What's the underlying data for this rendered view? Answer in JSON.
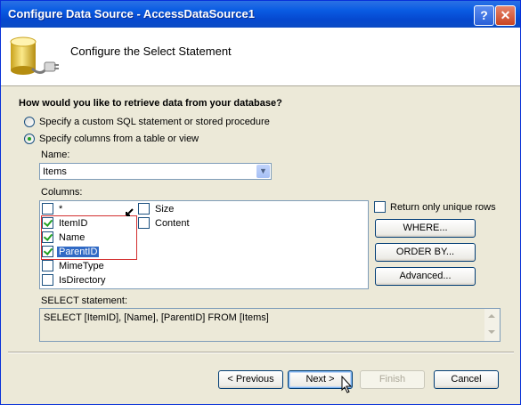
{
  "window": {
    "title": "Configure Data Source - AccessDataSource1",
    "help_glyph": "?",
    "close_glyph": "✕"
  },
  "header": {
    "title": "Configure the Select Statement",
    "icon": "database-plug-icon"
  },
  "main": {
    "question": "How would you like to retrieve data from your database?",
    "radio_custom": {
      "label": "Specify a custom SQL statement or stored procedure",
      "selected": false
    },
    "radio_columns": {
      "label": "Specify columns from a table or view",
      "selected": true
    },
    "name_label": "Name:",
    "name_value": "Items",
    "columns_label": "Columns:",
    "columns": [
      {
        "label": "*",
        "checked": false
      },
      {
        "label": "ItemID",
        "checked": true
      },
      {
        "label": "Name",
        "checked": true
      },
      {
        "label": "ParentID",
        "checked": true,
        "highlighted": true
      },
      {
        "label": "MimeType",
        "checked": false
      },
      {
        "label": "IsDirectory",
        "checked": false
      },
      {
        "label": "Size",
        "checked": false
      },
      {
        "label": "Content",
        "checked": false
      }
    ],
    "unique_rows_label": "Return only unique rows",
    "where_button": "WHERE...",
    "orderby_button": "ORDER BY...",
    "advanced_button": "Advanced...",
    "select_label": "SELECT statement:",
    "select_statement": "SELECT [ItemID], [Name], [ParentID] FROM [Items]"
  },
  "footer": {
    "previous": "< Previous",
    "next": "Next >",
    "finish": "Finish",
    "cancel": "Cancel"
  },
  "colors": {
    "titlebar": "#0a5ce3",
    "dialog_bg": "#ece9d8",
    "highlight": "#316ac5",
    "annotation_box": "#d32f2f"
  }
}
